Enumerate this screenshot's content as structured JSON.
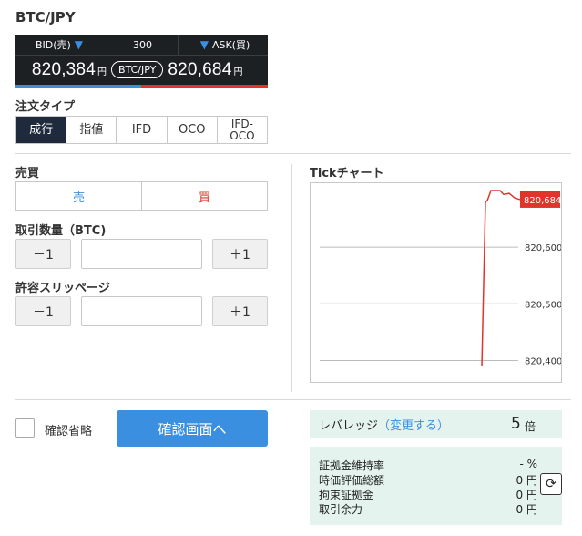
{
  "pair_title": "BTC/JPY",
  "quote": {
    "bid_label": "BID(売)",
    "ask_label": "ASK(買)",
    "bid_arrow": "🡇",
    "ask_arrow": "🡇",
    "spread": "300",
    "bid_price": "820,384",
    "ask_price": "820,684",
    "yen": "円",
    "pair": "BTC/JPY",
    "colors": {
      "bid": "#3b8fe0",
      "ask": "#e0352b",
      "panel": "#1d2023"
    }
  },
  "order_type": {
    "label": "注文タイプ",
    "options": [
      "成行",
      "指値",
      "IFD",
      "OCO",
      "IFD-\nOCO"
    ],
    "selected": "成行"
  },
  "side": {
    "label": "売買",
    "sell": "売",
    "buy": "買"
  },
  "quantity": {
    "label": "取引数量（BTC)",
    "minus": "－1",
    "plus": "＋1",
    "value": ""
  },
  "slippage": {
    "label": "許容スリッページ",
    "minus": "－1",
    "plus": "＋1",
    "value": ""
  },
  "tick_chart": {
    "label": "Tickチャート",
    "price_badge": "820,684",
    "badge_color": "#e0352b"
  },
  "chart_data": {
    "type": "line",
    "title": "Tickチャート",
    "xlabel": "",
    "ylabel": "",
    "y_ticks": [
      "820,600",
      "820,500",
      "820,400"
    ],
    "ylim": [
      820375,
      820700
    ],
    "grid": true,
    "series": [
      {
        "values": [
          820390,
          820680,
          820682,
          820700,
          820700,
          820693,
          820695,
          820687,
          820684
        ]
      }
    ],
    "last_value_label": "820,684"
  },
  "confirm_skip": {
    "label": "確認省略",
    "checked": false
  },
  "confirm_button": "確認画面へ",
  "leverage": {
    "label": "レバレッジ",
    "change_link": "（変更する）",
    "value": "5",
    "unit": "倍"
  },
  "account": {
    "rows": [
      {
        "key": "証拠金維持率",
        "value": "- %"
      },
      {
        "key": "時価評価総額",
        "value": "0 円"
      },
      {
        "key": "拘束証拠金",
        "value": "0 円"
      },
      {
        "key": "取引余力",
        "value": "0 円"
      }
    ]
  }
}
